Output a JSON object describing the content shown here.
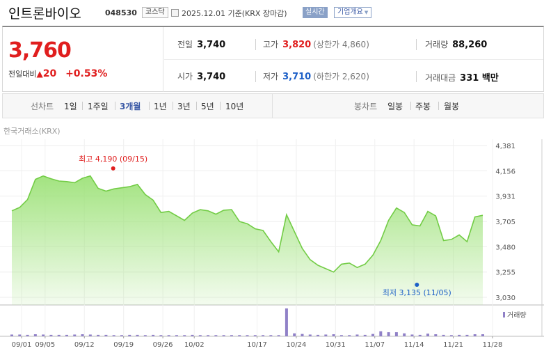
{
  "header": {
    "name": "인트론바이오",
    "code": "048530",
    "market": "코스닥",
    "date_text": "2025.12.01  기준(KRX 장마감)",
    "realtime_label": "실시간",
    "company_info_label": "기업개요"
  },
  "quote": {
    "price": "3,760",
    "change_label": "전일대비",
    "change_value": "20",
    "change_pct": "+0.53%",
    "prev_close_label": "전일",
    "prev_close": "3,740",
    "high_label": "고가",
    "high": "3,820",
    "upper_limit_text": "(상한가 4,860)",
    "volume_label": "거래량",
    "volume": "88,260",
    "open_label": "시가",
    "open": "3,740",
    "low_label": "저가",
    "low": "3,710",
    "lower_limit_text": "(하한가 2,620)",
    "amount_label": "거래대금",
    "amount": "331 백만"
  },
  "tabs": {
    "line_label": "선차트",
    "line_periods": [
      "1일",
      "1주일",
      "3개월",
      "1년",
      "3년",
      "5년",
      "10년"
    ],
    "active_period": "3개월",
    "candle_label": "봉차트",
    "candle_periods": [
      "일봉",
      "주봉",
      "월봉"
    ]
  },
  "source_label": "한국거래소(KRX)",
  "colors": {
    "up": "#e01e1e",
    "down": "#1c5fc7",
    "area": "#9ee27a",
    "line": "#72cc45",
    "volume": "#9081c7"
  },
  "chart_data": {
    "type": "area",
    "title": "",
    "y_ticks": [
      "4,381",
      "4,156",
      "3,931",
      "3,705",
      "3,480",
      "3,255",
      "3,030"
    ],
    "ylim": [
      3030,
      4381
    ],
    "x_ticks": [
      "09/01",
      "09/05",
      "09/12",
      "09/19",
      "09/26",
      "10/02",
      "10/17",
      "10/24",
      "10/31",
      "11/07",
      "11/14",
      "11/21",
      "11/28"
    ],
    "high_annotation": "최고 4,190 (09/15)",
    "low_annotation": "최저 3,135 (11/05)",
    "high_point": {
      "index": 13,
      "value": 4190
    },
    "low_point": {
      "index": 54,
      "value": 3135
    },
    "volume_legend": "거래량",
    "series": [
      {
        "values": [
          3800,
          3830,
          3900,
          4080,
          4110,
          4085,
          4065,
          4060,
          4050,
          4090,
          4110,
          4000,
          3975,
          3995,
          4005,
          4015,
          4035,
          3945,
          3895,
          3785,
          3795,
          3755,
          3715,
          3780,
          3810,
          3800,
          3770,
          3805,
          3810,
          3705,
          3685,
          3640,
          3625,
          3525,
          3435,
          3765,
          3615,
          3465,
          3365,
          3315,
          3285,
          3255,
          3325,
          3335,
          3295,
          3325,
          3405,
          3535,
          3715,
          3825,
          3785,
          3675,
          3665,
          3795,
          3755,
          3535,
          3545,
          3585,
          3525,
          3745,
          3760
        ]
      }
    ],
    "volume": [
      6,
      6,
      5,
      7,
      6,
      5,
      5,
      5,
      6,
      7,
      6,
      5,
      5,
      4,
      4,
      5,
      5,
      4,
      5,
      4,
      4,
      4,
      4,
      5,
      4,
      4,
      4,
      4,
      4,
      4,
      4,
      4,
      4,
      4,
      4,
      95,
      10,
      8,
      6,
      5,
      6,
      7,
      4,
      4,
      6,
      5,
      8,
      17,
      14,
      14,
      10,
      6,
      5,
      9,
      7,
      5,
      4,
      5,
      5,
      7,
      7
    ]
  }
}
